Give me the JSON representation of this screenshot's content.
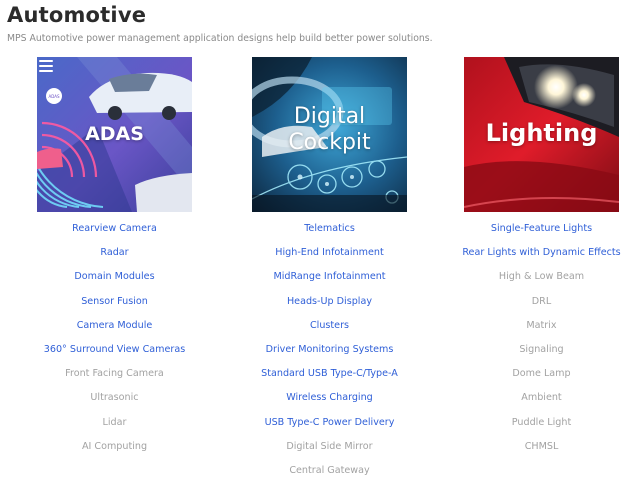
{
  "page": {
    "title": "Automotive",
    "subtitle": "MPS Automotive power management application designs help build better power solutions."
  },
  "colors": {
    "active_link": "#2f5fd7",
    "muted_link": "#a2a2a2"
  },
  "columns": [
    {
      "tile_label": "ADAS",
      "tile_badge": "ADAS",
      "links": [
        {
          "label": "Rearview Camera",
          "active": true
        },
        {
          "label": "Radar",
          "active": true
        },
        {
          "label": "Domain Modules",
          "active": true
        },
        {
          "label": "Sensor Fusion",
          "active": true
        },
        {
          "label": "Camera Module",
          "active": true
        },
        {
          "label": "360° Surround View Cameras",
          "active": true
        },
        {
          "label": "Front Facing Camera",
          "active": false
        },
        {
          "label": "Ultrasonic",
          "active": false
        },
        {
          "label": "Lidar",
          "active": false
        },
        {
          "label": "AI Computing",
          "active": false
        }
      ]
    },
    {
      "tile_label": "Digital\nCockpit",
      "links": [
        {
          "label": "Telematics",
          "active": true
        },
        {
          "label": "High-End Infotainment",
          "active": true
        },
        {
          "label": "MidRange Infotainment",
          "active": true
        },
        {
          "label": "Heads-Up Display",
          "active": true
        },
        {
          "label": "Clusters",
          "active": true
        },
        {
          "label": "Driver Monitoring Systems",
          "active": true
        },
        {
          "label": "Standard USB Type-C/Type-A",
          "active": true
        },
        {
          "label": "Wireless Charging",
          "active": true
        },
        {
          "label": "USB Type-C Power Delivery",
          "active": true
        },
        {
          "label": "Digital Side Mirror",
          "active": false
        },
        {
          "label": "Central Gateway",
          "active": false
        }
      ]
    },
    {
      "tile_label": "Lighting",
      "links": [
        {
          "label": "Single-Feature Lights",
          "active": true
        },
        {
          "label": "Rear Lights with Dynamic Effects",
          "active": true
        },
        {
          "label": "High & Low Beam",
          "active": false
        },
        {
          "label": "DRL",
          "active": false
        },
        {
          "label": "Matrix",
          "active": false
        },
        {
          "label": "Signaling",
          "active": false
        },
        {
          "label": "Dome Lamp",
          "active": false
        },
        {
          "label": "Ambient",
          "active": false
        },
        {
          "label": "Puddle Light",
          "active": false
        },
        {
          "label": "CHMSL",
          "active": false
        }
      ]
    }
  ]
}
